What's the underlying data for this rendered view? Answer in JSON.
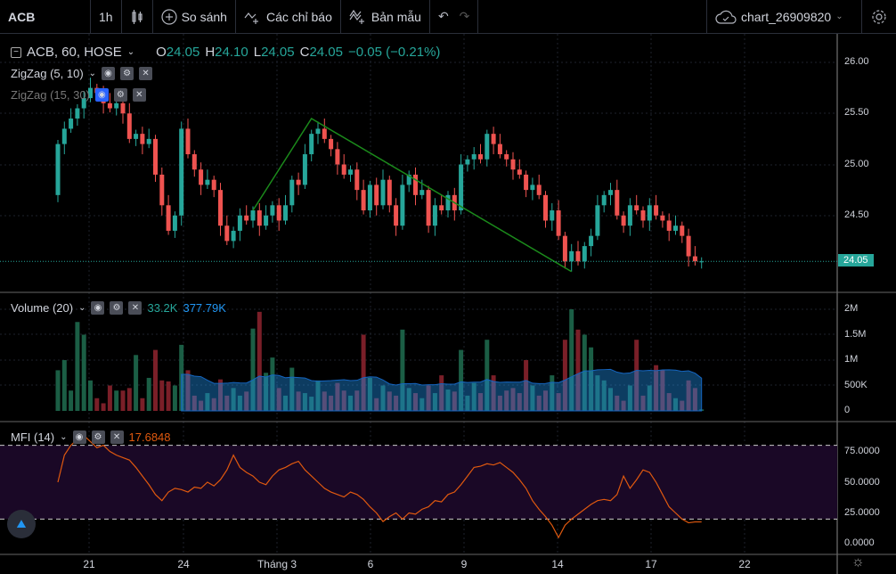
{
  "toolbar": {
    "symbol": "ACB",
    "interval": "1h",
    "compare": "So sánh",
    "indicators": "Các chỉ báo",
    "templates": "Bản mẫu",
    "chart_name": "chart_26909820"
  },
  "legend": {
    "title": "ACB, 60, HOSE",
    "o_label": "O",
    "o": "24.05",
    "h_label": "H",
    "h": "24.10",
    "l_label": "L",
    "l": "24.05",
    "c_label": "C",
    "c": "24.05",
    "change": "−0.05 (−0.21%)",
    "zigzag1": "ZigZag (5, 10)",
    "zigzag2": "ZigZag (15, 30)"
  },
  "volume": {
    "label": "Volume (20)",
    "value": "33.2K",
    "ma": "377.79K",
    "axis": [
      "2M",
      "1.5M",
      "1M",
      "500K",
      "0"
    ]
  },
  "mfi": {
    "label": "MFI (14)",
    "value": "17.6848",
    "axis": [
      "75.0000",
      "50.0000",
      "25.0000",
      "0.0000"
    ],
    "upper": 80,
    "lower": 20
  },
  "price_axis": [
    "26.00",
    "25.50",
    "25.00",
    "24.50"
  ],
  "last_price": "24.05",
  "time_axis": [
    "21",
    "24",
    "Tháng 3",
    "6",
    "9",
    "14",
    "17",
    "22"
  ],
  "colors": {
    "up": "#26a69a",
    "down": "#ef5350",
    "zigzag": "#1b8a1b",
    "mfi": "#e0590f",
    "volma": "#2196f3",
    "last": "#26a69a"
  },
  "chart_data": {
    "type": "candlestick",
    "first_open": 24.7,
    "closes": [
      25.2,
      25.35,
      25.45,
      25.55,
      25.65,
      25.75,
      25.7,
      25.6,
      25.55,
      25.6,
      25.5,
      25.25,
      25.3,
      25.2,
      25.25,
      24.9,
      24.6,
      24.35,
      24.5,
      25.35,
      25.1,
      24.95,
      24.8,
      24.85,
      24.75,
      24.4,
      24.25,
      24.35,
      24.5,
      24.45,
      24.55,
      24.4,
      24.5,
      24.6,
      24.45,
      24.6,
      24.85,
      24.8,
      25.1,
      25.3,
      25.35,
      25.25,
      25.15,
      25.0,
      24.9,
      24.95,
      24.75,
      24.55,
      24.8,
      24.6,
      24.85,
      24.6,
      24.4,
      24.8,
      24.9,
      24.7,
      24.75,
      24.4,
      24.6,
      24.55,
      24.7,
      24.55,
      25.0,
      25.05,
      25.1,
      25.05,
      25.3,
      25.2,
      25.1,
      25.05,
      24.95,
      24.9,
      24.75,
      24.8,
      24.7,
      24.45,
      24.55,
      24.3,
      24.05,
      24.15,
      24.05,
      24.2,
      24.3,
      24.6,
      24.7,
      24.75,
      24.5,
      24.4,
      24.6,
      24.55,
      24.45,
      24.6,
      24.5,
      24.45,
      24.35,
      24.4,
      24.3,
      24.1,
      24.05,
      24.05
    ],
    "volume_k": [
      800,
      1000,
      400,
      1750,
      1500,
      600,
      250,
      150,
      500,
      400,
      400,
      450,
      1100,
      250,
      650,
      1200,
      600,
      580,
      500,
      1300,
      800,
      300,
      200,
      350,
      250,
      620,
      300,
      450,
      300,
      380,
      1620,
      1950,
      750,
      1050,
      450,
      300,
      850,
      380,
      350,
      280,
      600,
      380,
      300,
      550,
      400,
      300,
      400,
      1500,
      650,
      250,
      500,
      380,
      300,
      1600,
      450,
      350,
      250,
      500,
      350,
      700,
      420,
      380,
      1200,
      300,
      550,
      350,
      1400,
      700,
      300,
      400,
      450,
      350,
      1000,
      500,
      300,
      400,
      700,
      350,
      1400,
      2000,
      1600,
      1500,
      1250,
      700,
      600,
      450,
      300,
      200,
      500,
      1400,
      300,
      500,
      900,
      800,
      350,
      250,
      200,
      600,
      450,
      30
    ],
    "mfi": [
      50,
      72,
      80,
      85,
      88,
      83,
      78,
      80,
      75,
      72,
      70,
      68,
      62,
      55,
      48,
      40,
      35,
      42,
      45,
      44,
      42,
      46,
      45,
      50,
      47,
      52,
      60,
      72,
      62,
      58,
      55,
      50,
      48,
      55,
      60,
      62,
      65,
      67,
      60,
      55,
      50,
      45,
      42,
      40,
      38,
      42,
      40,
      36,
      30,
      25,
      18,
      22,
      25,
      20,
      25,
      24,
      28,
      30,
      35,
      34,
      40,
      42,
      48,
      55,
      62,
      63,
      65,
      64,
      66,
      62,
      58,
      52,
      45,
      35,
      28,
      22,
      15,
      5,
      15,
      20,
      24,
      28,
      32,
      35,
      36,
      35,
      40,
      55,
      45,
      52,
      60,
      58,
      50,
      40,
      30,
      25,
      20,
      17,
      17.7,
      17.7
    ],
    "zigzag": [
      [
        30,
        24.55
      ],
      [
        39,
        25.45
      ],
      [
        79,
        23.95
      ]
    ]
  }
}
